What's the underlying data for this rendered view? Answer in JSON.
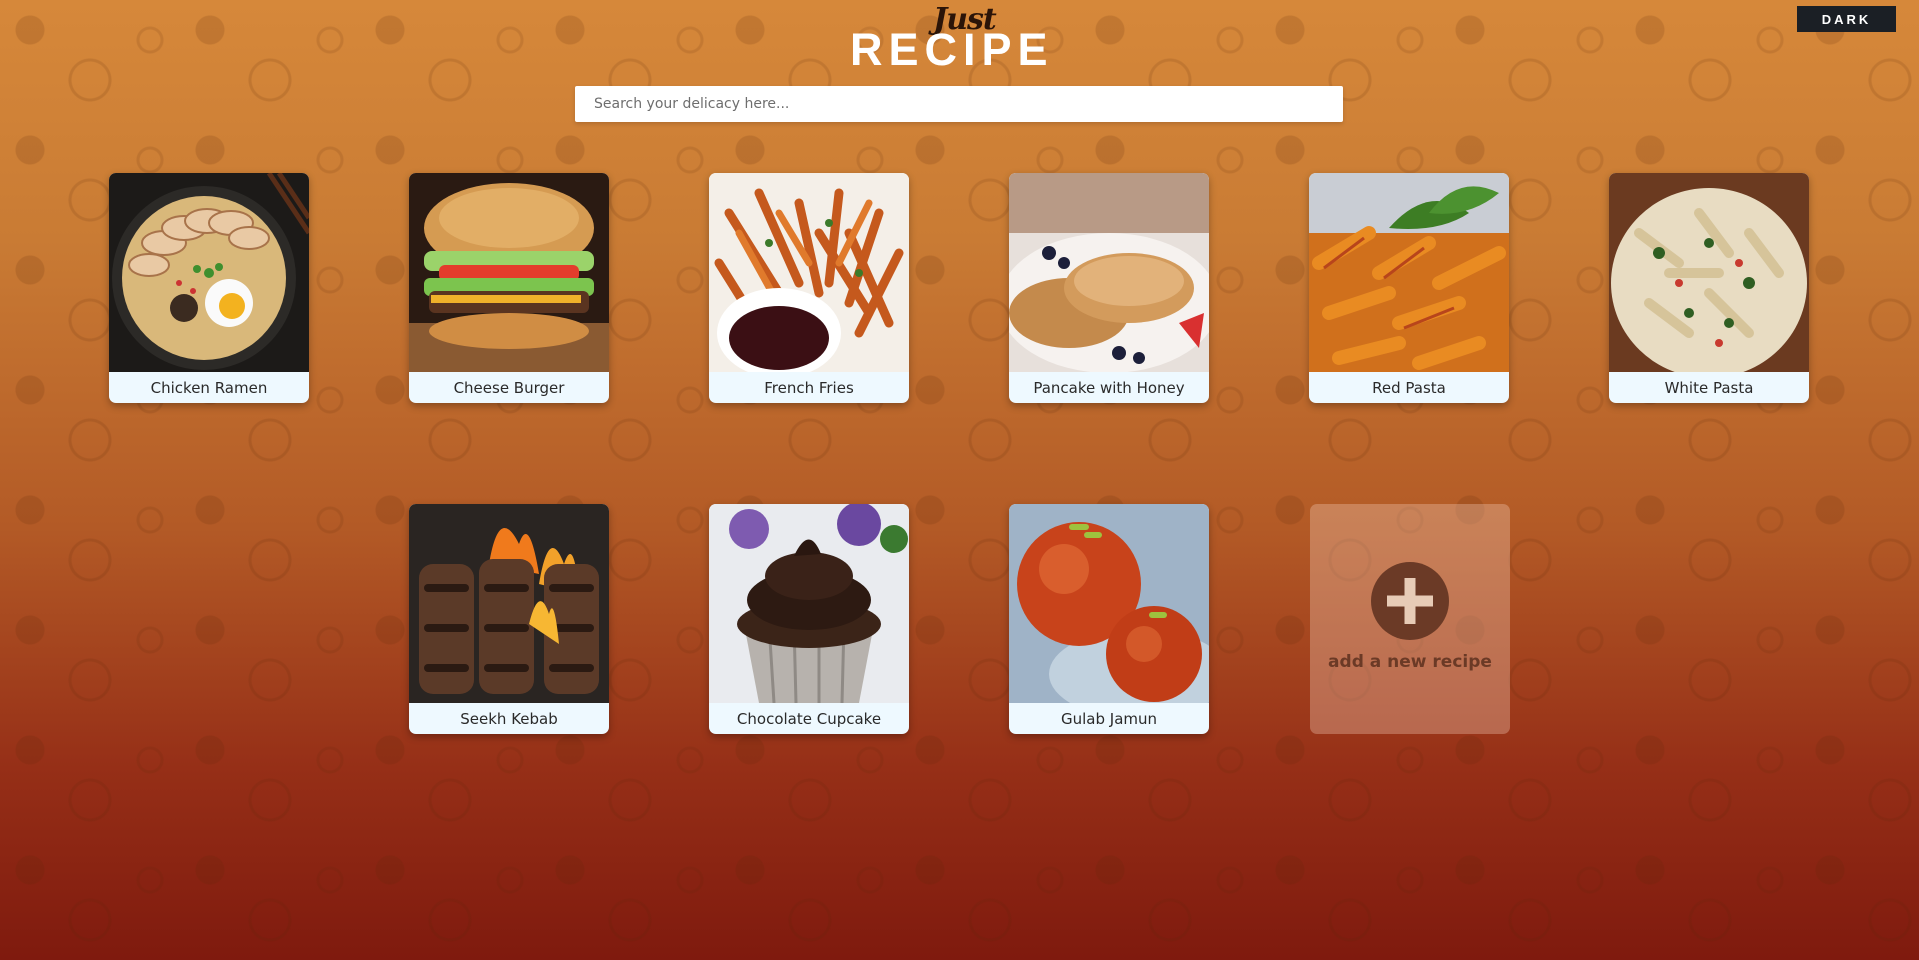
{
  "header": {
    "logo_small": "Just",
    "logo_large": "RECIPE",
    "theme_toggle_label": "DARK"
  },
  "search": {
    "placeholder": "Search your delicacy here...",
    "value": ""
  },
  "recipes": [
    {
      "label": "Chicken Ramen",
      "image": "chicken-ramen-photo"
    },
    {
      "label": "Cheese Burger",
      "image": "cheese-burger-photo"
    },
    {
      "label": "French Fries",
      "image": "french-fries-photo"
    },
    {
      "label": "Pancake with Honey",
      "image": "pancake-photo"
    },
    {
      "label": "Red Pasta",
      "image": "red-pasta-photo"
    },
    {
      "label": "White Pasta",
      "image": "white-pasta-photo"
    },
    {
      "label": "Seekh Kebab",
      "image": "seekh-kebab-photo"
    },
    {
      "label": "Chocolate Cupcake",
      "image": "chocolate-cupcake-photo"
    },
    {
      "label": "Gulab Jamun",
      "image": "gulab-jamun-photo"
    }
  ],
  "add_recipe": {
    "label": "add a new recipe",
    "icon": "plus-icon"
  }
}
